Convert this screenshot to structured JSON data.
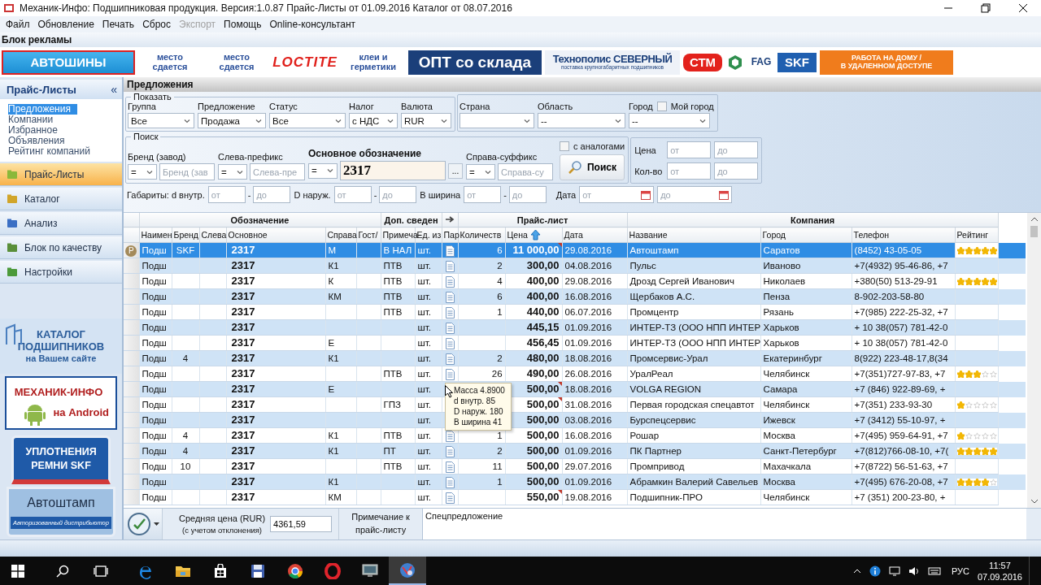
{
  "window": {
    "title": "Механик-Инфо: Подшипниковая продукция. Версия:1.0.87 Прайс-Листы от 01.09.2016 Каталог от 08.07.2016"
  },
  "menu": [
    {
      "label": "Файл",
      "disabled": false
    },
    {
      "label": "Обновление",
      "disabled": false
    },
    {
      "label": "Печать",
      "disabled": false
    },
    {
      "label": "Сброс",
      "disabled": false
    },
    {
      "label": "Экспорт",
      "disabled": true
    },
    {
      "label": "Помощь",
      "disabled": false
    },
    {
      "label": "Online-консультант",
      "disabled": false
    }
  ],
  "ad_block": {
    "title": "Блок рекламы",
    "ads": [
      {
        "kind": "boxed",
        "lines": [
          "АВТОШИНЫ"
        ]
      },
      {
        "kind": "text",
        "lines": [
          "место",
          "сдается"
        ]
      },
      {
        "kind": "text",
        "lines": [
          "место",
          "сдается"
        ]
      },
      {
        "kind": "script",
        "lines": [
          "LOCTITE"
        ]
      },
      {
        "kind": "text",
        "lines": [
          "клеи и",
          "герметики"
        ]
      },
      {
        "kind": "dark",
        "lines": [
          "ОПТ со склада"
        ]
      },
      {
        "kind": "brand",
        "lines": [
          "Технополис СЕВЕРНЫЙ",
          "поставка крупногабаритных подшипников"
        ]
      },
      {
        "kind": "stm",
        "lines": [
          "СТМ"
        ]
      },
      {
        "kind": "emblem"
      },
      {
        "kind": "fag",
        "lines": [
          "FAG"
        ]
      },
      {
        "kind": "skf",
        "lines": [
          "SKF"
        ]
      },
      {
        "kind": "orange",
        "lines": [
          "РАБОТА НА ДОМУ /",
          "В УДАЛЕННОМ ДОСТУПЕ"
        ]
      }
    ]
  },
  "sidebar": {
    "title": "Прайс-Листы",
    "collapse": "«",
    "links": [
      {
        "label": "Предложения",
        "selected": true
      },
      {
        "label": "Компании",
        "selected": false
      },
      {
        "label": "Избранное",
        "selected": false
      },
      {
        "label": "Объявления",
        "selected": false
      },
      {
        "label": "Рейтинг компаний",
        "selected": false
      }
    ],
    "nav": [
      {
        "kind": "price",
        "label": "Прайс-Листы",
        "selected": true
      },
      {
        "kind": "catalog",
        "label": "Каталог",
        "selected": false
      },
      {
        "kind": "analysis",
        "label": "Анализ",
        "selected": false
      },
      {
        "kind": "quality",
        "label": "Блок по качеству",
        "selected": false
      },
      {
        "kind": "settings",
        "label": "Настройки",
        "selected": false
      }
    ],
    "promos": [
      {
        "kind": "catalog",
        "lines": [
          "КАТАЛОГ",
          "ПОДШИПНИКОВ",
          "на Вашем сайте"
        ]
      },
      {
        "kind": "android",
        "lines": [
          "МЕХАНИК-ИНФО",
          "на Android"
        ]
      },
      {
        "kind": "seals",
        "lines": [
          "УПЛОТНЕНИЯ",
          "РЕМНИ SKF"
        ]
      },
      {
        "kind": "dealer",
        "lines": [
          "Автоштамп",
          "Авторизованный дистрибьютор"
        ]
      }
    ]
  },
  "panel": {
    "title": "Предложения"
  },
  "filters": {
    "show": {
      "legend": "Показать",
      "fields": [
        {
          "label": "Группа",
          "value": "Все"
        },
        {
          "label": "Предложение",
          "value": "Продажа"
        },
        {
          "label": "Статус",
          "value": "Все"
        },
        {
          "label": "Налог",
          "value": "с НДС"
        },
        {
          "label": "Валюта",
          "value": "RUR"
        }
      ]
    },
    "region": {
      "fields": [
        {
          "label": "Страна"
        },
        {
          "label": "Область",
          "value": "--"
        },
        {
          "label": "Город",
          "value": "--"
        }
      ],
      "my_city": {
        "label": "Мой город",
        "checked": false
      }
    },
    "search": {
      "legend": "Поиск",
      "parts": [
        {
          "label": "Бренд (завод)",
          "op": "=",
          "placeholder": "Бренд (зав"
        },
        {
          "label": "Слева-префикс",
          "op": "=",
          "placeholder": "Слева-пре"
        },
        {
          "kind": "main",
          "label": "Основное обозначение",
          "op": "=",
          "value": "2317",
          "more": "..."
        },
        {
          "label": "Справа-суффикс",
          "op": "=",
          "placeholder": "Справа-су"
        }
      ],
      "analogs": {
        "label": "с аналогами",
        "checked": false
      },
      "button": "Поиск"
    },
    "ranges": [
      {
        "label": "Цена",
        "from": {
          "placeholder": "от"
        },
        "to": {
          "placeholder": "до"
        }
      },
      {
        "label": "Кол-во",
        "from": {
          "placeholder": "от"
        },
        "to": {
          "placeholder": "до"
        }
      }
    ],
    "dims": [
      {
        "label": "Габариты: d внутр.",
        "from": {
          "placeholder": "от"
        },
        "sep": "-",
        "to": {
          "placeholder": "до"
        }
      },
      {
        "label": "D наруж.",
        "from": {
          "placeholder": "от"
        },
        "sep": "-",
        "to": {
          "placeholder": "до"
        }
      },
      {
        "label": "В ширина",
        "from": {
          "placeholder": "от"
        },
        "sep": "-",
        "to": {
          "placeholder": "до"
        }
      }
    ],
    "date": {
      "label": "Дата",
      "from": {
        "placeholder": "от"
      },
      "to": {
        "placeholder": "до"
      }
    }
  },
  "table": {
    "groups": [
      "Обозначение",
      "Доп. сведен",
      "Прайс-лист",
      "Компания"
    ],
    "columns": [
      {
        "label": "Наимен"
      },
      {
        "label": "Бренд"
      },
      {
        "label": "Слева"
      },
      {
        "label": "Основное"
      },
      {
        "label": "Справа"
      },
      {
        "label": "Гост/"
      },
      {
        "label": "Примеча"
      },
      {
        "label": "Ед. из"
      },
      {
        "label": "Пар"
      },
      {
        "label": "Количеств"
      },
      {
        "label": "Цена",
        "sorted": true
      },
      {
        "label": "Дата"
      },
      {
        "label": "Название"
      },
      {
        "label": "Город"
      },
      {
        "label": "Телефон"
      },
      {
        "label": "Рейтинг"
      }
    ],
    "rows": [
      {
        "selected": true,
        "indicator": "P",
        "name": "Подш",
        "brand": "SKF",
        "main": "2317",
        "suffix": "М",
        "note": "В НАЛ",
        "unit": "шт.",
        "params": true,
        "qty": "6",
        "price": "11 000,00",
        "flagged": true,
        "date": "29.08.2016",
        "company": "Автоштамп",
        "city": "Саратов",
        "phone": "(8452) 43-05-05",
        "stars": 5
      },
      {
        "selected": false,
        "name": "Подш",
        "main": "2317",
        "suffix": "К1",
        "note": "ПТВ",
        "unit": "шт.",
        "params": true,
        "qty": "2",
        "price": "300,00",
        "flagged": false,
        "date": "04.08.2016",
        "company": "Пульс",
        "city": "Иваново",
        "phone": "+7(4932) 95-46-86, +7"
      },
      {
        "selected": false,
        "name": "Подш",
        "main": "2317",
        "suffix": "К",
        "note": "ПТВ",
        "unit": "шт.",
        "params": true,
        "qty": "4",
        "price": "400,00",
        "flagged": false,
        "date": "29.08.2016",
        "company": "Дрозд Сергей Иванович",
        "city": "Николаев",
        "phone": "+380(50) 513-29-91",
        "stars": 5
      },
      {
        "selected": false,
        "name": "Подш",
        "main": "2317",
        "suffix": "КМ",
        "note": "ПТВ",
        "unit": "шт.",
        "params": true,
        "qty": "6",
        "price": "400,00",
        "flagged": false,
        "date": "16.08.2016",
        "company": "Щербаков А.С.",
        "city": "Пенза",
        "phone": "8-902-203-58-80"
      },
      {
        "selected": false,
        "name": "Подш",
        "main": "2317",
        "note": "ПТВ",
        "unit": "шт.",
        "params": true,
        "qty": "1",
        "price": "440,00",
        "flagged": false,
        "date": "06.07.2016",
        "company": "Промцентр",
        "city": "Рязань",
        "phone": "+7(985) 222-25-32, +7"
      },
      {
        "selected": false,
        "name": "Подш",
        "main": "2317",
        "unit": "шт.",
        "params": true,
        "price": "445,15",
        "flagged": false,
        "date": "01.09.2016",
        "company": "ИНТЕР-ТЗ (ООО НПП ИНТЕР",
        "city": "Харьков",
        "phone": "+ 10 38(057) 781-42-0"
      },
      {
        "selected": false,
        "name": "Подш",
        "main": "2317",
        "suffix": "Е",
        "unit": "шт.",
        "params": true,
        "price": "456,45",
        "flagged": false,
        "date": "01.09.2016",
        "company": "ИНТЕР-ТЗ (ООО НПП ИНТЕР",
        "city": "Харьков",
        "phone": "+ 10 38(057) 781-42-0"
      },
      {
        "selected": false,
        "name": "Подш",
        "brand": "4",
        "main": "2317",
        "suffix": "К1",
        "unit": "шт.",
        "params": true,
        "qty": "2",
        "price": "480,00",
        "flagged": false,
        "date": "18.08.2016",
        "company": "Промсервис-Урал",
        "city": "Екатеринбург",
        "phone": "8(922) 223-48-17,8(34"
      },
      {
        "selected": false,
        "name": "Подш",
        "main": "2317",
        "note": "ПТВ",
        "unit": "шт.",
        "params": true,
        "qty": "26",
        "price": "490,00",
        "flagged": false,
        "date": "26.08.2016",
        "company": "УралРеал",
        "city": "Челябинск",
        "phone": "+7(351)727-97-83,  +7",
        "stars": 3
      },
      {
        "selected": false,
        "name": "Подш",
        "main": "2317",
        "suffix": "Е",
        "unit": "шт.",
        "params": false,
        "price": "500,00",
        "flagged": true,
        "date": "18.08.2016",
        "company": "VOLGA REGION",
        "city": "Самара",
        "phone": "+7 (846) 922-89-69, +"
      },
      {
        "selected": false,
        "name": "Подш",
        "main": "2317",
        "note": "ГПЗ",
        "unit": "шт.",
        "params": false,
        "price": "500,00",
        "flagged": true,
        "date": "31.08.2016",
        "company": "Первая городская спецавтот",
        "city": "Челябинск",
        "phone": "+7(351) 233-93-30",
        "stars": 1
      },
      {
        "selected": false,
        "name": "Подш",
        "main": "2317",
        "unit": "шт.",
        "params": false,
        "price": "500,00",
        "flagged": false,
        "date": "03.08.2016",
        "company": "Бурспецсервис",
        "city": "Ижевск",
        "phone": "+7 (3412) 55-10-97, +"
      },
      {
        "selected": false,
        "name": "Подш",
        "brand": "4",
        "main": "2317",
        "suffix": "К1",
        "note": "ПТВ",
        "unit": "шт.",
        "params": true,
        "qty": "1",
        "price": "500,00",
        "flagged": false,
        "date": "16.08.2016",
        "company": "Рошар",
        "city": "Москва",
        "phone": "+7(495) 959-64-91, +7",
        "stars": 1
      },
      {
        "selected": false,
        "name": "Подш",
        "brand": "4",
        "main": "2317",
        "suffix": "К1",
        "note": "ПТ",
        "unit": "шт.",
        "params": true,
        "qty": "2",
        "price": "500,00",
        "flagged": false,
        "date": "01.09.2016",
        "company": "ПК Партнер",
        "city": "Санкт-Петербург",
        "phone": "+7(812)766-08-10, +7(",
        "stars": 5
      },
      {
        "selected": false,
        "name": "Подш",
        "brand": "10",
        "main": "2317",
        "note": "ПТВ",
        "unit": "шт.",
        "params": true,
        "qty": "11",
        "price": "500,00",
        "flagged": false,
        "date": "29.07.2016",
        "company": "Промпривод",
        "city": "Махачкала",
        "phone": "+7(8722) 56-51-63, +7"
      },
      {
        "selected": false,
        "name": "Подш",
        "main": "2317",
        "suffix": "К1",
        "unit": "шт.",
        "params": true,
        "qty": "1",
        "price": "500,00",
        "flagged": false,
        "date": "01.09.2016",
        "company": "Абрамкин Валерий Савельев",
        "city": "Москва",
        "phone": "+7(495) 676-20-08, +7",
        "stars": 4
      },
      {
        "selected": false,
        "name": "Подш",
        "main": "2317",
        "suffix": "КМ",
        "unit": "шт.",
        "params": true,
        "price": "550,00",
        "flagged": true,
        "date": "19.08.2016",
        "company": "Подшипник-ПРО",
        "city": "Челябинск",
        "phone": "+7 (351) 200-23-80, +"
      }
    ]
  },
  "tooltip": {
    "lines": [
      "Масса 4.8900",
      "d внутр. 85",
      "D наруж. 180",
      "В ширина 41"
    ]
  },
  "footer": {
    "avg_label": "Средняя цена (RUR)",
    "avg_sublabel": "(с учетом отклонения)",
    "avg_value": "4361,59",
    "note_label": "Примечание к прайс-листу",
    "note_value": "Спецпредложение"
  },
  "taskbar": {
    "apps": [
      {
        "kind": "edge",
        "selected": false
      },
      {
        "kind": "folder",
        "selected": false
      },
      {
        "kind": "store",
        "selected": false
      },
      {
        "kind": "floppy",
        "selected": false
      },
      {
        "kind": "chrome",
        "selected": false
      },
      {
        "kind": "opera",
        "selected": false
      },
      {
        "kind": "monitor",
        "selected": false
      },
      {
        "kind": "sphere",
        "selected": true
      }
    ],
    "lang": "РУС",
    "time": "11:57",
    "date": "07.09.2016"
  }
}
